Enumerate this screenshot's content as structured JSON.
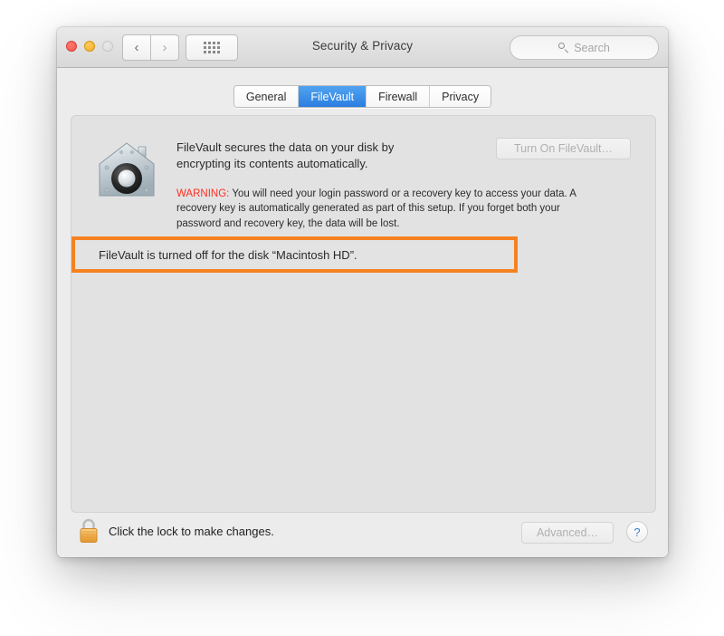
{
  "window": {
    "title": "Security & Privacy",
    "traffic_lights": [
      {
        "name": "close",
        "label": "Close",
        "color": "#f4524b",
        "enabled": true
      },
      {
        "name": "minimize",
        "label": "Minimize",
        "color": "#f5ae22",
        "enabled": true
      },
      {
        "name": "zoom",
        "label": "Zoom",
        "color": "#dcdcdc",
        "enabled": false
      }
    ],
    "nav": {
      "back": "‹",
      "forward": "›"
    },
    "show_all_label": "Show All"
  },
  "search": {
    "placeholder": "Search",
    "value": "",
    "icon": "search-icon"
  },
  "tabs": [
    {
      "label": "General",
      "active": false
    },
    {
      "label": "FileVault",
      "active": true
    },
    {
      "label": "Firewall",
      "active": false
    },
    {
      "label": "Privacy",
      "active": false
    }
  ],
  "panel": {
    "icon": "filevault-house-icon",
    "description": "FileVault secures the data on your disk by encrypting its contents automatically.",
    "turn_on_button": {
      "label": "Turn On FileVault…",
      "enabled": false
    },
    "warning": {
      "prefix": "WARNING:",
      "text": " You will need your login password or a recovery key to access your data. A recovery key is automatically generated as part of this setup. If you forget both your password and recovery key, the data will be lost.",
      "prefix_color": "#ff2f21"
    },
    "status": {
      "text": "FileVault is turned off for the disk “Macintosh HD”."
    }
  },
  "footer": {
    "lock_icon": "lock-closed-icon",
    "lock_text": "Click the lock to make changes.",
    "advanced_button": {
      "label": "Advanced…",
      "enabled": false
    },
    "help_button": {
      "label": "?"
    }
  },
  "annotations": {
    "highlight_color": "#f58220",
    "targets": [
      "tab-filevault",
      "status-message"
    ]
  }
}
